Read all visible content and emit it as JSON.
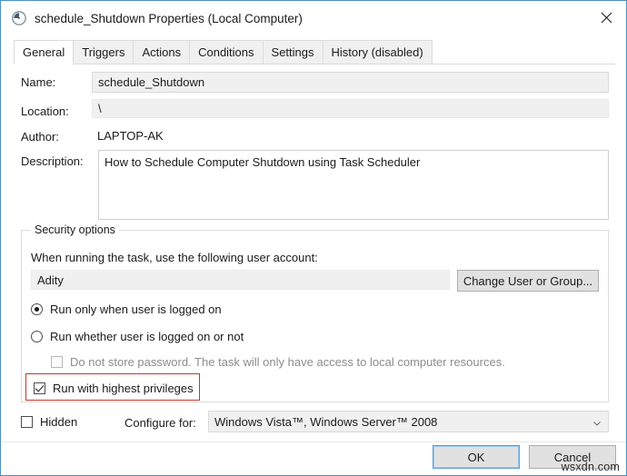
{
  "window": {
    "title": "schedule_Shutdown Properties (Local Computer)",
    "icon": "clock-schedule-icon",
    "close_label": "close-icon"
  },
  "tabs": [
    {
      "label": "General",
      "active": true
    },
    {
      "label": "Triggers",
      "active": false
    },
    {
      "label": "Actions",
      "active": false
    },
    {
      "label": "Conditions",
      "active": false
    },
    {
      "label": "Settings",
      "active": false
    },
    {
      "label": "History (disabled)",
      "active": false
    }
  ],
  "general": {
    "name_label": "Name:",
    "name_value": "schedule_Shutdown",
    "location_label": "Location:",
    "location_value": "\\",
    "author_label": "Author:",
    "author_value": "LAPTOP-AK",
    "description_label": "Description:",
    "description_value": "How to Schedule Computer Shutdown using Task Scheduler"
  },
  "security": {
    "group_title": "Security options",
    "account_prompt": "When running the task, use the following user account:",
    "account_value": "Adity",
    "change_user_button": "Change User or Group...",
    "radio_logged_on": "Run only when user is logged on",
    "radio_logged_on_checked": true,
    "radio_whether": "Run whether user is logged on or not",
    "radio_whether_checked": false,
    "checkbox_no_password": "Do not store password.  The task will only have access to local computer resources.",
    "checkbox_no_password_checked": false,
    "checkbox_no_password_disabled": true,
    "checkbox_highest": "Run with highest privileges",
    "checkbox_highest_checked": true,
    "highlight_color": "#c0392b"
  },
  "bottom": {
    "hidden_label": "Hidden",
    "hidden_checked": false,
    "configure_for_label": "Configure for:",
    "configure_for_value": "Windows Vista™, Windows Server™ 2008",
    "configure_for_icon": "chevron-down-icon"
  },
  "footer": {
    "ok_label": "OK",
    "cancel_label": "Cancel"
  },
  "watermark": {
    "text": "wsxdn.com"
  }
}
